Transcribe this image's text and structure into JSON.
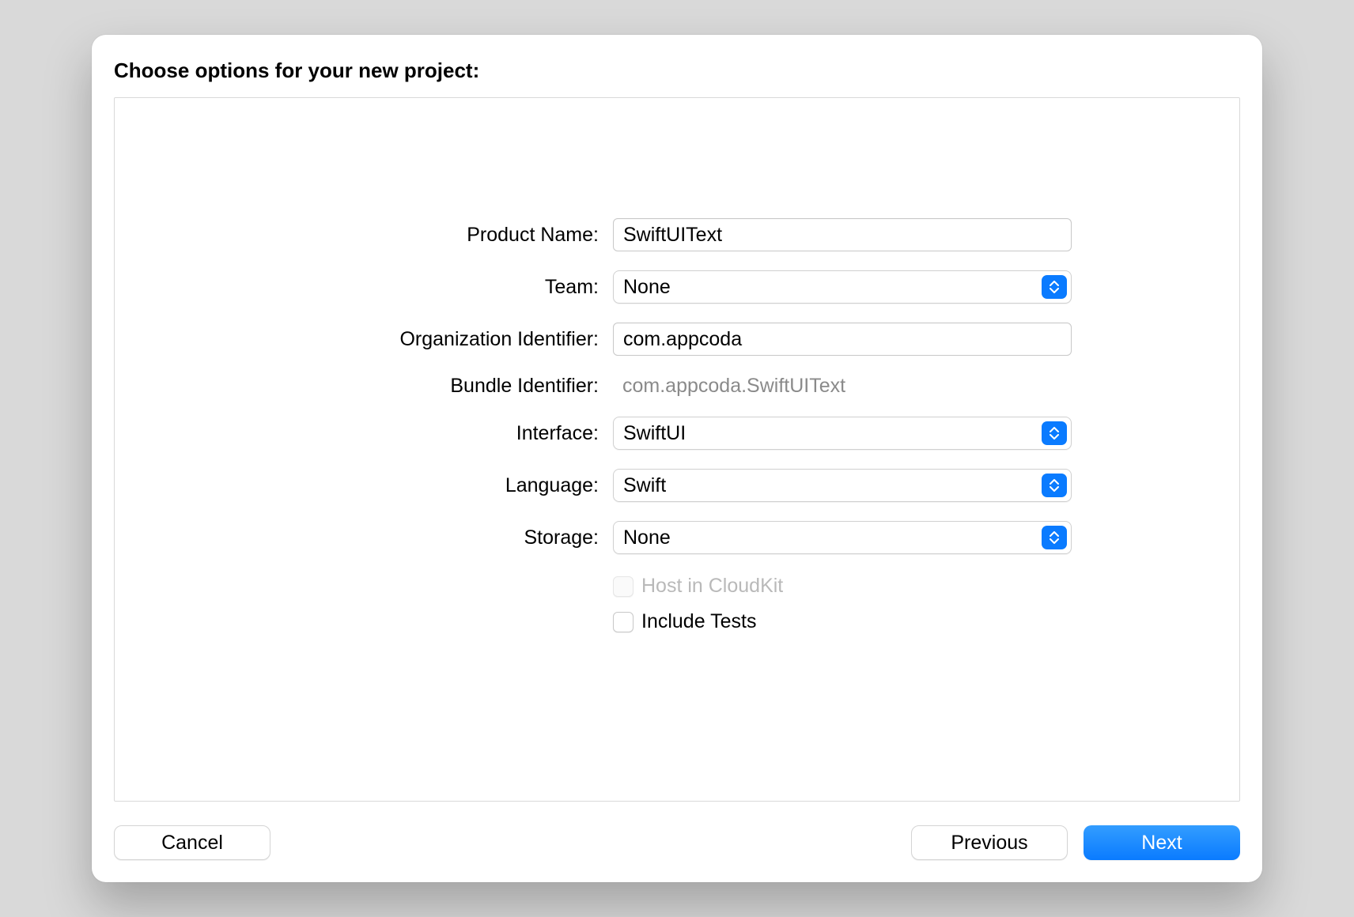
{
  "heading": "Choose options for your new project:",
  "form": {
    "productName": {
      "label": "Product Name:",
      "value": "SwiftUIText"
    },
    "team": {
      "label": "Team:",
      "value": "None"
    },
    "orgIdentifier": {
      "label": "Organization Identifier:",
      "value": "com.appcoda"
    },
    "bundleIdentifier": {
      "label": "Bundle Identifier:",
      "value": "com.appcoda.SwiftUIText"
    },
    "interface": {
      "label": "Interface:",
      "value": "SwiftUI"
    },
    "language": {
      "label": "Language:",
      "value": "Swift"
    },
    "storage": {
      "label": "Storage:",
      "value": "None"
    },
    "hostCloudKit": {
      "label": "Host in CloudKit"
    },
    "includeTests": {
      "label": "Include Tests"
    }
  },
  "footer": {
    "cancel": "Cancel",
    "previous": "Previous",
    "next": "Next"
  }
}
